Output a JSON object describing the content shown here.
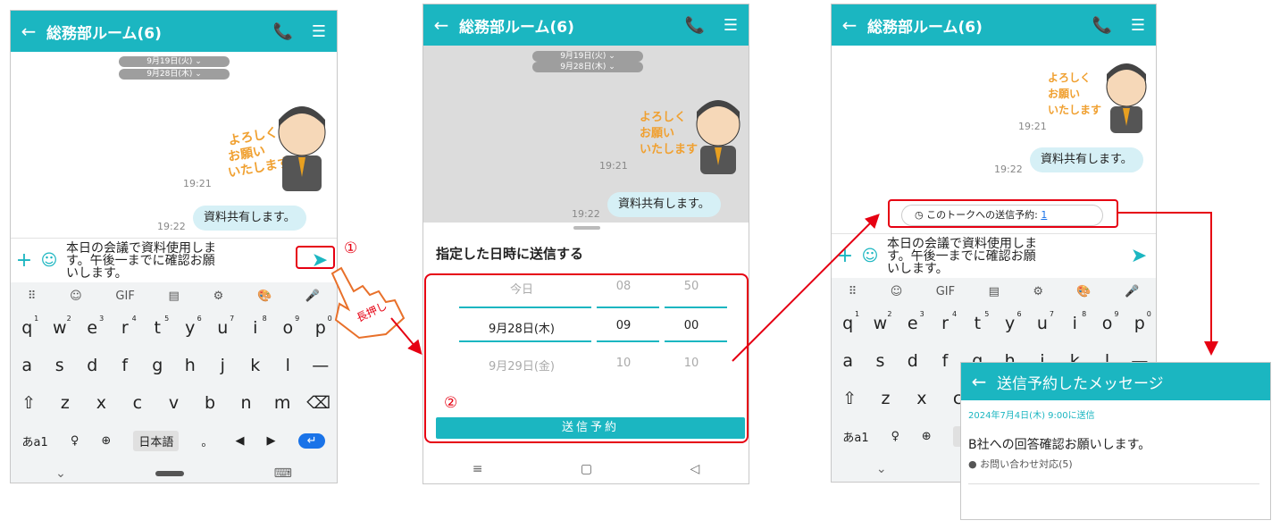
{
  "room_title": "総務部ルーム(6)",
  "date_pills": [
    "9月19日(火) ⌄",
    "9月28日(木) ⌄"
  ],
  "stamp_text": "よろしくお願いいたします",
  "messages": {
    "stamp_time": "19:21",
    "msg_time": "19:22",
    "msg_text": "資料共有します。"
  },
  "compose": {
    "line1": "本日の会議で資料使用しま",
    "line2": "す。午後一までに確認お願",
    "line3": "いします。"
  },
  "keyboard": {
    "toolbar": [
      "⠿",
      "☺",
      "GIF",
      "▤",
      "⚙",
      "🎨",
      "🎤"
    ],
    "row1": [
      [
        "q",
        "1"
      ],
      [
        "w",
        "2"
      ],
      [
        "e",
        "3"
      ],
      [
        "r",
        "4"
      ],
      [
        "t",
        "5"
      ],
      [
        "y",
        "6"
      ],
      [
        "u",
        "7"
      ],
      [
        "i",
        "8"
      ],
      [
        "o",
        "9"
      ],
      [
        "p",
        "0"
      ]
    ],
    "row2": [
      "a",
      "s",
      "d",
      "f",
      "g",
      "h",
      "j",
      "k",
      "l",
      "—"
    ],
    "row3": [
      "⇧",
      "z",
      "x",
      "c",
      "v",
      "b",
      "n",
      "m",
      "⌫"
    ],
    "row4": [
      "あa1",
      "♀",
      "⊕",
      "日本語",
      "。",
      "◀",
      "▶",
      "↵"
    ]
  },
  "annotations": {
    "num1": "①",
    "num2": "②",
    "longpress": "長押し"
  },
  "schedule": {
    "heading": "指定した日時に送信する",
    "rows": [
      [
        "今日",
        "08",
        "50"
      ],
      [
        "9月28日(木)",
        "09",
        "00"
      ],
      [
        "9月29日(金)",
        "10",
        "10"
      ]
    ],
    "button": "送信予約"
  },
  "reserve_chip": {
    "label": "このトークへの送信予約:",
    "count": "1"
  },
  "reserved_panel": {
    "title": "送信予約したメッセージ",
    "datetime": "2024年7月4日(木) 9:00に送信",
    "message": "B社への回答確認お願いします。",
    "room": "● お問い合わせ対応(5)"
  },
  "colors": {
    "accent": "#1bb6c1",
    "red": "#e60012",
    "bubble": "#d6f0f6"
  }
}
